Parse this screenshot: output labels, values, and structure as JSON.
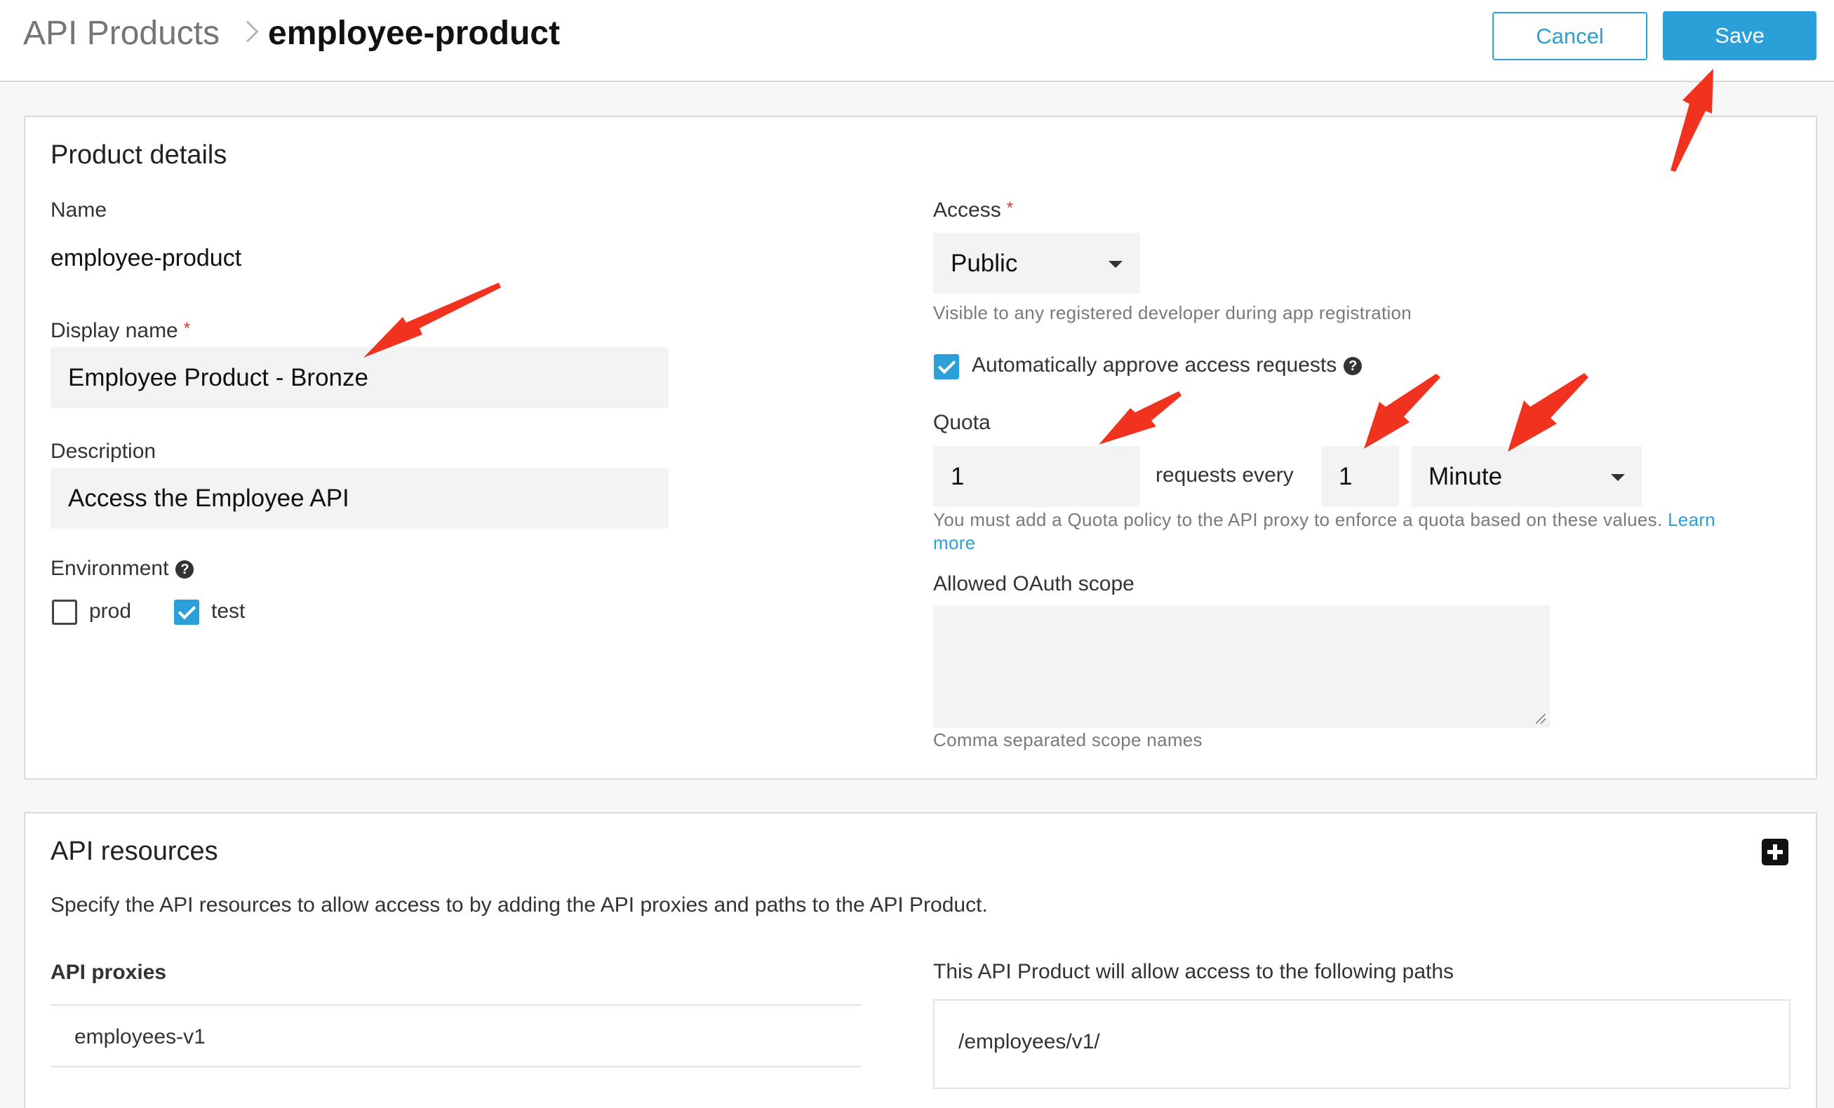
{
  "header": {
    "breadcrumb_parent": "API Products",
    "breadcrumb_current": "employee-product",
    "cancel_label": "Cancel",
    "save_label": "Save"
  },
  "product_details": {
    "title": "Product details",
    "name_label": "Name",
    "name_value": "employee-product",
    "display_name_label": "Display name",
    "display_name_required": "*",
    "display_name_value": "Employee Product - Bronze",
    "description_label": "Description",
    "description_value": "Access the Employee API",
    "environment_label": "Environment",
    "environments": [
      {
        "label": "prod",
        "checked": false
      },
      {
        "label": "test",
        "checked": true
      }
    ],
    "access_label": "Access",
    "access_required": "*",
    "access_value": "Public",
    "access_help": "Visible to any registered developer during app registration",
    "auto_approve_label": "Automatically approve access requests",
    "auto_approve_checked": true,
    "quota_label": "Quota",
    "quota_count": "1",
    "quota_requests_every": "requests every",
    "quota_interval": "1",
    "quota_unit": "Minute",
    "quota_help": "You must add a Quota policy to the API proxy to enforce a quota based on these values.",
    "quota_help_link_1": "Learn",
    "quota_help_link_2": "more",
    "oauth_label": "Allowed OAuth scope",
    "oauth_value": "",
    "oauth_help": "Comma separated scope names"
  },
  "api_resources": {
    "title": "API resources",
    "description": "Specify the API resources to allow access to by adding the API proxies and paths to the API Product.",
    "proxies_label": "API proxies",
    "proxies": [
      "employees-v1"
    ],
    "paths_label": "This API Product will allow access to the following paths",
    "paths": [
      "/employees/v1/"
    ]
  },
  "colors": {
    "accent": "#2a9fd8",
    "required": "#e4302f",
    "annotation_arrow": "#f0321e"
  }
}
